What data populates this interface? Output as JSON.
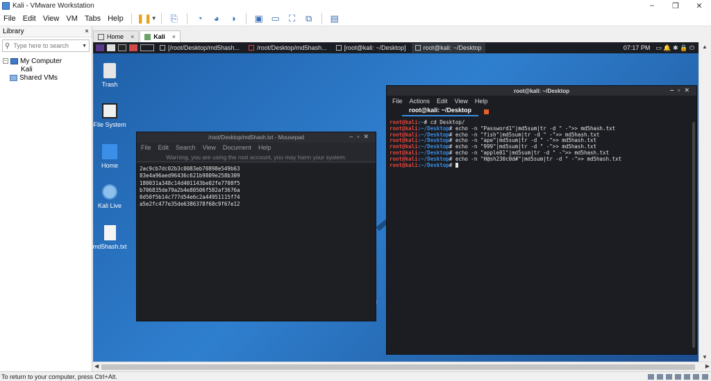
{
  "window": {
    "title": "Kali - VMware Workstation",
    "controls": [
      "–",
      "❐",
      "✕"
    ]
  },
  "menubar": {
    "items": [
      "File",
      "Edit",
      "View",
      "VM",
      "Tabs",
      "Help"
    ]
  },
  "library": {
    "title": "Library",
    "close": "×",
    "search_placeholder": "Type here to search",
    "tree": {
      "my_computer": "My Computer",
      "kali": "Kali",
      "shared": "Shared VMs",
      "expander": "–"
    }
  },
  "tabs": [
    {
      "label": "Home",
      "close": "×"
    },
    {
      "label": "Kali",
      "close": "×"
    }
  ],
  "kali_panel": {
    "tasks": [
      "[/root/Desktop/md5hash...",
      "/root/Desktop/md5hash...",
      "[root@kali: ~/Desktop]",
      "root@kali: ~/Desktop"
    ],
    "time": "07:17 PM"
  },
  "desktop_icons": [
    "Trash",
    "File System",
    "Home",
    "Kali Live",
    "md5hash.txt"
  ],
  "mousepad": {
    "title": "/root/Desktop/md5hash.txt - Mousepad",
    "menu": [
      "File",
      "Edit",
      "Search",
      "View",
      "Document",
      "Help"
    ],
    "warning": "Warning, you are using the root account, you may harm your system.",
    "lines": [
      "2ac9cb7dc02b3c0083eb70898e549b63",
      "83e4a96aed96436c621b9809e258b309",
      "180031a348c14d401143be02fe7708f5",
      "b706835de79a2b4e80506f582af3676a",
      "0d50f5b14c777d54e6c2a44951115f74",
      "a5e2fc477e35de6386378f68c9f67e12"
    ]
  },
  "terminal": {
    "title": "root@kali: ~/Desktop",
    "menu": [
      "File",
      "Actions",
      "Edit",
      "View",
      "Help"
    ],
    "tab": "root@kali: ~/Desktop",
    "lines": [
      {
        "user": "root@kali",
        "path": ":~",
        "cmd": "# cd Desktop/"
      },
      {
        "user": "root@kali",
        "path": ":~/Desktop",
        "cmd": "# echo -n \"Password1\"|md5sum|tr -d \" -\">> md5hash.txt"
      },
      {
        "user": "root@kali",
        "path": ":~/Desktop",
        "cmd": "# echo -n \"fish\"|md5sum|tr -d \" -\">> md5hash.txt"
      },
      {
        "user": "root@kali",
        "path": ":~/Desktop",
        "cmd": "# echo -n \"ape\"|md5sum|tr -d \" -\">> md5hash.txt"
      },
      {
        "user": "root@kali",
        "path": ":~/Desktop",
        "cmd": "# echo -n \"999\"|md5sum|tr -d \" -\">> md5hash.txt"
      },
      {
        "user": "root@kali",
        "path": ":~/Desktop",
        "cmd": "# echo -n \"apple01\"|md5sum|tr -d \" -\">> md5hash.txt"
      },
      {
        "user": "root@kali",
        "path": ":~/Desktop",
        "cmd": "# echo -n \"H@sh230c0d#\"|md5sum|tr -d \" -\">> md5hash.txt"
      },
      {
        "user": "root@kali",
        "path": ":~/Desktop",
        "cmd": "# "
      }
    ]
  },
  "statusbar": {
    "text": "To return to your computer, press Ctrl+Alt."
  },
  "colors": {
    "prompt_user": "#e8463c",
    "prompt_path": "#3b8fe8",
    "desktop": "#2f7fcf"
  }
}
